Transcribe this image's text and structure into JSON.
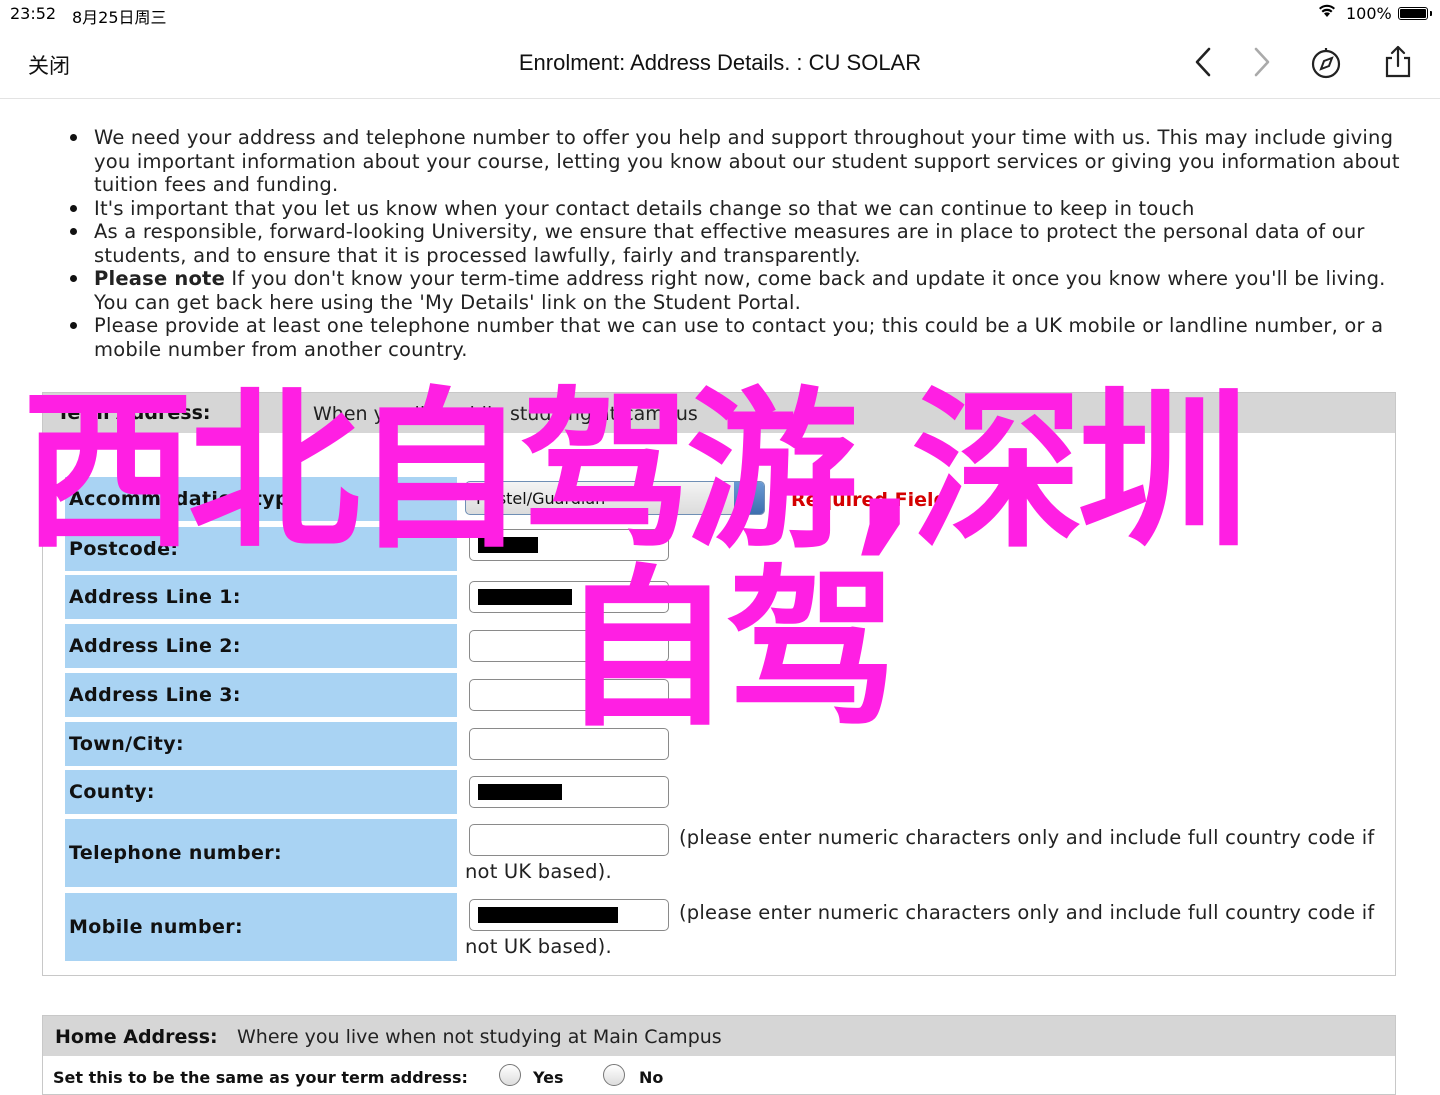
{
  "status_bar": {
    "time": "23:52",
    "date": "8月25日周三",
    "battery": "100%",
    "wifi_icon": "wifi-icon",
    "battery_icon": "battery-icon"
  },
  "nav": {
    "close_label": "关闭",
    "title": "Enrolment: Address Details. : CU SOLAR",
    "icons": [
      "back-icon",
      "forward-icon",
      "compass-icon",
      "share-icon"
    ]
  },
  "bullets": [
    {
      "bold": "",
      "text": "We need your address and telephone number to offer you help and support throughout your time with us. This may include giving you important information about your course, letting you know about our student support services or giving you information about tuition fees and funding."
    },
    {
      "bold": "",
      "text": "It's important that you let us know when your contact details change so that we can continue to keep in touch"
    },
    {
      "bold": "",
      "text": "As a responsible, forward-looking University, we ensure that effective measures are in place to protect the personal data of our students, and to ensure that it is processed lawfully, fairly and transparently."
    },
    {
      "bold": "Please note",
      "text": " If you don't know your term-time address right now, come back and update it once you know where you'll be living. You can get back here using the 'My Details' link on the Student Portal."
    },
    {
      "bold": "",
      "text": "Please provide at least one telephone number that we can use to contact you; this could be a UK mobile or landline number, or a mobile number from another country."
    }
  ],
  "term_address": {
    "header_label": "Term Address:",
    "header_desc": "When you live while studying at campus",
    "accommodation_label": "Accommodation type",
    "accommodation_value": "Hostel/Guardian",
    "required_text": "Required Field",
    "rows": [
      {
        "label": "Postcode:"
      },
      {
        "label": "Address Line 1:"
      },
      {
        "label": "Address Line 2:"
      },
      {
        "label": "Address Line 3:"
      },
      {
        "label": "Town/City:"
      },
      {
        "label": "County:"
      },
      {
        "label": "Telephone number:"
      },
      {
        "label": "Mobile number:"
      }
    ],
    "phone_hint": "(please enter numeric characters only and include full country code if not UK based).",
    "mobile_hint": "(please enter numeric characters only and include full country code if not UK based)."
  },
  "home_address": {
    "header_label": "Home Address:",
    "header_desc": "Where you live when not studying at Main Campus",
    "question": "Set this to be the same as your term address:",
    "yes_label": "Yes",
    "no_label": "No"
  },
  "overlay": {
    "line1": "西北自驾游,深圳",
    "line2": "自驾",
    "color": "#ff1fe3"
  },
  "colors": {
    "label_bg": "#a9d3f3",
    "header_bg": "#d6d6d6",
    "required": "#d40000"
  }
}
